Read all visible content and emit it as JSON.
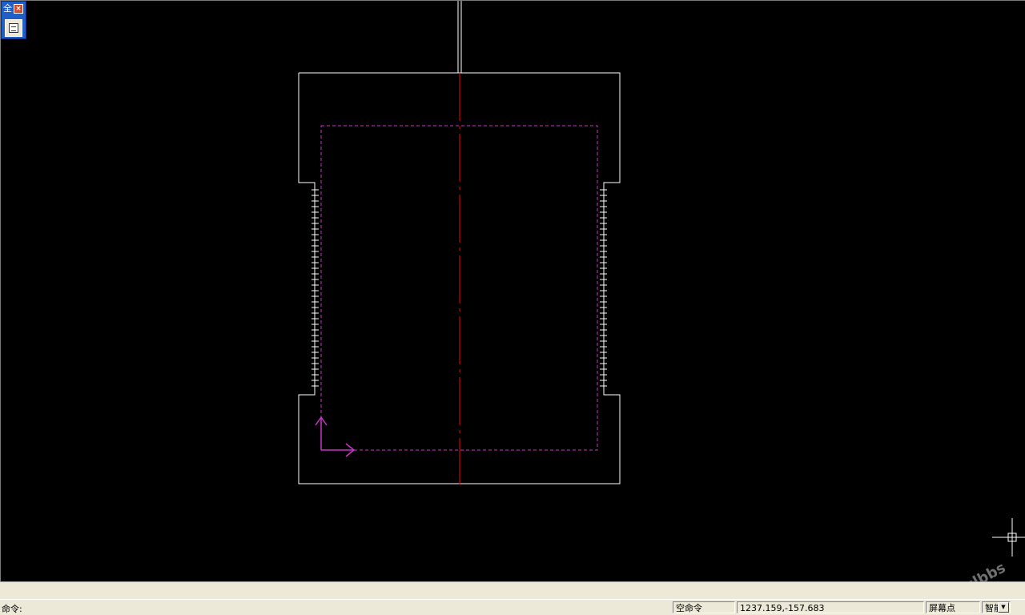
{
  "mini_toolbar": {
    "title": "全",
    "close_icon": "close-icon",
    "button_icon": "window-icon"
  },
  "command_bar": {
    "prompt": "命令:",
    "value": ""
  },
  "status": {
    "current_command": "空命令",
    "coordinates": "1237.159,-157.683",
    "snap_mode": "屏幕点",
    "smart_mode": "智能"
  },
  "drawing": {
    "outline_color": "#ffffff",
    "centerline_color": "#ff0000",
    "hidden_line_color": "#cc33cc",
    "ucs_icon": "ucs-axis-icon",
    "cursor_icon": "crosshair-cursor-icon"
  },
  "watermark": "Rclbbs"
}
